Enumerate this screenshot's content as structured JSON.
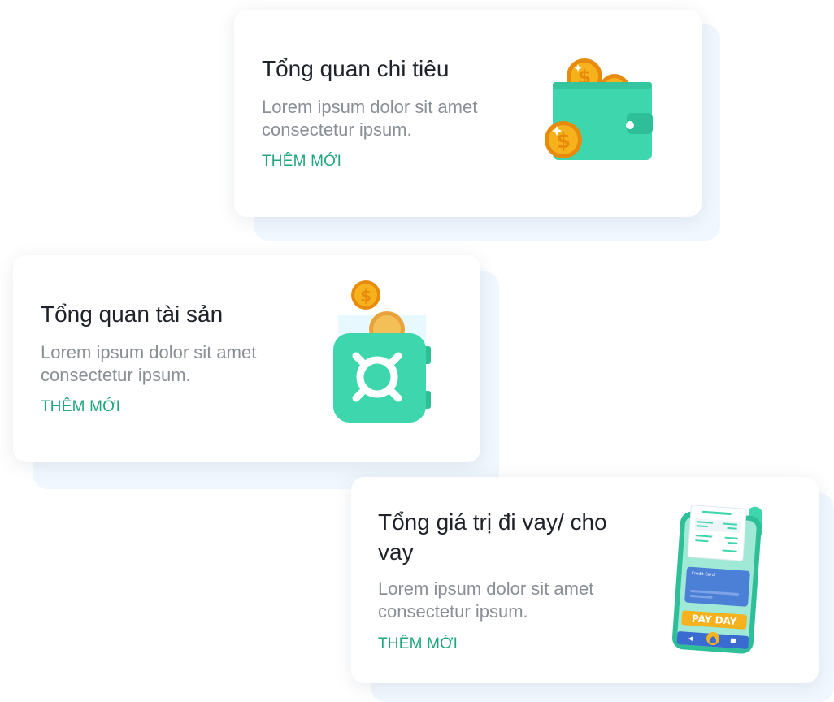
{
  "cards": [
    {
      "title": "Tổng quan chi tiêu",
      "description": "Lorem ipsum dolor sit amet consectetur ipsum.",
      "link": "THÊM MỚI",
      "icon": "wallet-coins-icon"
    },
    {
      "title": "Tổng quan tài sản",
      "description": "Lorem ipsum dolor sit amet consectetur ipsum.",
      "link": "THÊM MỚI",
      "icon": "safe-coins-icon"
    },
    {
      "title": "Tổng giá trị đi vay/ cho vay",
      "description": "Lorem ipsum dolor sit amet consectetur ipsum.",
      "link": "THÊM MỚI",
      "icon": "phone-payday-icon",
      "illustration_text": {
        "payday": "PAY DAY",
        "card": "Credit Card"
      }
    }
  ],
  "colors": {
    "accent": "#1fa67e",
    "mint": "#3fd9b1",
    "coin": "#f3a312",
    "card_shadow": "#f1f7fe"
  }
}
